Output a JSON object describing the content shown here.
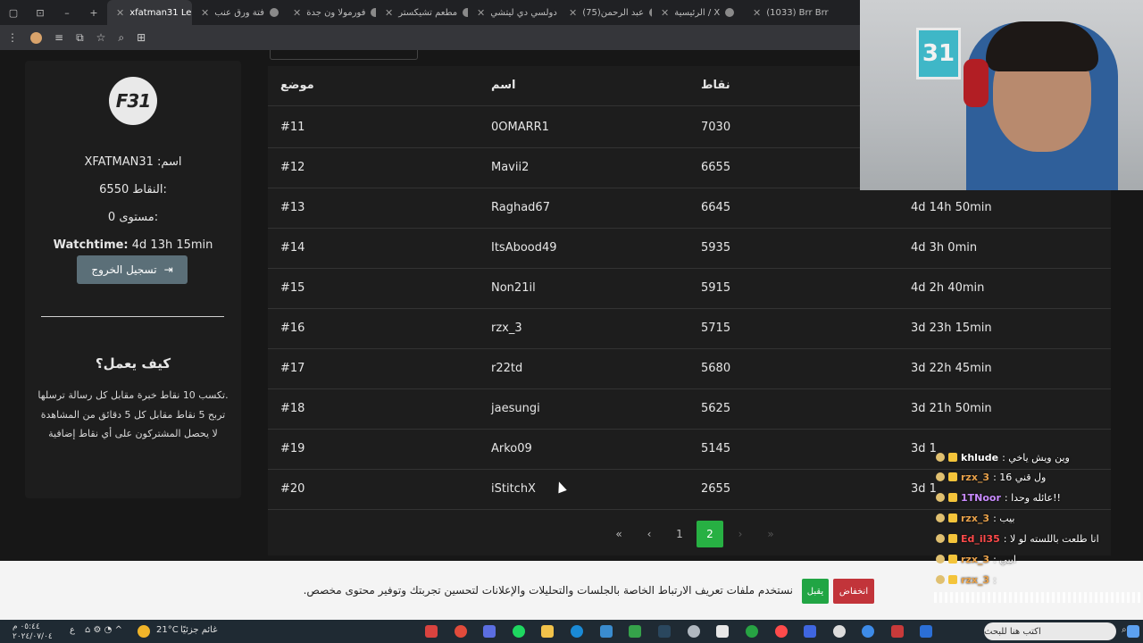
{
  "browser": {
    "tabs": [
      {
        "label": "xfatman31 Lea",
        "active": true
      },
      {
        "label": "فتة ورق عنب",
        "active": false
      },
      {
        "label": "فورمولا ون جدة",
        "active": false
      },
      {
        "label": "مطعم تشيكستر",
        "active": false
      },
      {
        "label": "دولسي دي ليتشي",
        "active": false
      },
      {
        "label": "(75)عبد الرحمن",
        "active": false
      },
      {
        "label": "الرئيسية / X",
        "active": false
      },
      {
        "label": "(1033) Brr Brr",
        "active": false
      }
    ]
  },
  "profile": {
    "avatar_text": "F31",
    "name_line": "XFATMAN31 :اسم",
    "points_line": "6550 النقاط:",
    "level_line": "0 مستوى:",
    "watchtime_label": "Watchtime:",
    "watchtime_value": "4d 13h 15min",
    "logout_label": "تسجيل الخروج",
    "how_title": "كيف يعمل؟",
    "how_lines": [
      "تكسب 10 نقاط خبرة مقابل كل رسالة ترسلها.",
      "تربح 5 نقاط مقابل كل 5 دقائق من المشاهدة",
      "لا يحصل المشتركون على أي نقاط إضافية"
    ]
  },
  "table": {
    "headers": [
      "موضع",
      "اسم",
      "نقاط",
      ""
    ],
    "rows": [
      {
        "pos": "#11",
        "name": "0OMARR1",
        "points": "7030",
        "time": ""
      },
      {
        "pos": "#12",
        "name": "Mavii2",
        "points": "6655",
        "time": ""
      },
      {
        "pos": "#13",
        "name": "Raghad67",
        "points": "6645",
        "time": "4d 14h 50min"
      },
      {
        "pos": "#14",
        "name": "ItsAbood49",
        "points": "5935",
        "time": "4d 3h 0min"
      },
      {
        "pos": "#15",
        "name": "Non21il",
        "points": "5915",
        "time": "4d 2h 40min"
      },
      {
        "pos": "#16",
        "name": "rzx_3",
        "points": "5715",
        "time": "3d 23h 15min"
      },
      {
        "pos": "#17",
        "name": "r22td",
        "points": "5680",
        "time": "3d 22h 45min"
      },
      {
        "pos": "#18",
        "name": "jaesungi",
        "points": "5625",
        "time": "3d 21h 50min"
      },
      {
        "pos": "#19",
        "name": "Arko09",
        "points": "5145",
        "time": "3d 1"
      },
      {
        "pos": "#20",
        "name": "iStitchX",
        "points": "2655",
        "time": "3d 1"
      }
    ],
    "pagination": {
      "first": "«",
      "prev": "‹",
      "pages": [
        "1",
        "2"
      ],
      "current": "2",
      "next": "›",
      "last": "»"
    }
  },
  "cookie": {
    "text": "نستخدم ملفات تعريف الارتباط الخاصة بالجلسات والتحليلات والإعلانات لتحسين تجربتك وتوفير محتوى مخصص.",
    "accept_label": "يقبل",
    "reduce_label": "انخفاض"
  },
  "chat": [
    {
      "user": "khlude",
      "msg": ": وين ويش ياخي",
      "color": "#ffffff"
    },
    {
      "user": "rzx_3",
      "msg": ": 16 ول قني",
      "color": "#e8a14a"
    },
    {
      "user": "1TNoor",
      "msg": ": عائله وحدا!!",
      "color": "#c98bff"
    },
    {
      "user": "rzx_3",
      "msg": ": بيب",
      "color": "#e8a14a"
    },
    {
      "user": "Ed_il35",
      "msg": ": انا طلعت باللسته لو لا",
      "color": "#ff4a4a"
    },
    {
      "user": "rzx_3",
      "msg": ": ابيي",
      "color": "#e8a14a"
    },
    {
      "user": "rzx_3",
      "msg": ":",
      "color": "#e8a14a"
    }
  ],
  "taskbar": {
    "weather_temp": "21°C",
    "weather_text": "غائم جزئيًا",
    "search_placeholder": "اكتب هنا للبحث",
    "clock_time": "٠٥:٤٤ م",
    "clock_date": "٢٠٢٤/٠٧/٠٤",
    "lang": "ع"
  },
  "colors": {
    "page_bg": "#171717",
    "panel_bg": "#1d1d1d",
    "accent_green": "#27b043",
    "cookie_reduce": "#c2343a",
    "logout_btn": "#5b6f78"
  },
  "webcam": {
    "frame_number": "31"
  }
}
